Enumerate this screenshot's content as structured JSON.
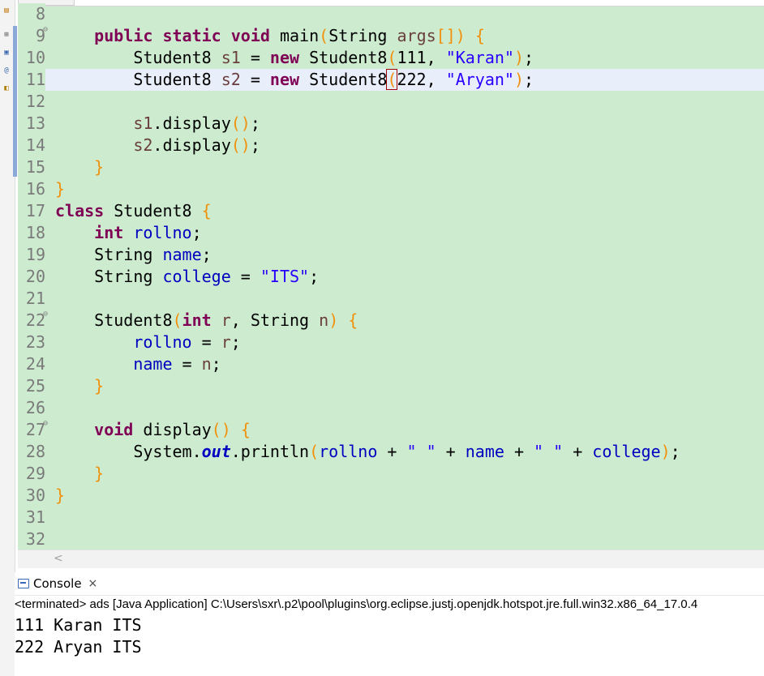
{
  "editor": {
    "lines": [
      {
        "n": "8",
        "fold": false,
        "current": false,
        "tokens": []
      },
      {
        "n": "9",
        "fold": true,
        "current": false,
        "tokens": [
          {
            "t": "    "
          },
          {
            "t": "public",
            "c": "kw"
          },
          {
            "t": " "
          },
          {
            "t": "static",
            "c": "kw"
          },
          {
            "t": " "
          },
          {
            "t": "void",
            "c": "kw"
          },
          {
            "t": " main"
          },
          {
            "t": "(",
            "c": "br"
          },
          {
            "t": "String "
          },
          {
            "t": "args",
            "c": "var"
          },
          {
            "t": "[]",
            "c": "br"
          },
          {
            "t": ")",
            "c": "br"
          },
          {
            "t": " "
          },
          {
            "t": "{",
            "c": "br"
          }
        ]
      },
      {
        "n": "10",
        "fold": false,
        "current": false,
        "tokens": [
          {
            "t": "        Student8 "
          },
          {
            "t": "s1",
            "c": "var"
          },
          {
            "t": " = "
          },
          {
            "t": "new",
            "c": "kw"
          },
          {
            "t": " Student8"
          },
          {
            "t": "(",
            "c": "br"
          },
          {
            "t": "111, "
          },
          {
            "t": "\"Karan\"",
            "c": "str"
          },
          {
            "t": ")",
            "c": "br"
          },
          {
            "t": ";"
          }
        ]
      },
      {
        "n": "11",
        "fold": false,
        "current": true,
        "tokens": [
          {
            "t": "        Student8 "
          },
          {
            "t": "s2",
            "c": "var"
          },
          {
            "t": " = "
          },
          {
            "t": "new",
            "c": "kw"
          },
          {
            "t": " Student8"
          },
          {
            "t": "(",
            "c": "br caret"
          },
          {
            "t": "222, "
          },
          {
            "t": "\"Aryan\"",
            "c": "str"
          },
          {
            "t": ")",
            "c": "br"
          },
          {
            "t": ";"
          }
        ]
      },
      {
        "n": "12",
        "fold": false,
        "current": false,
        "tokens": []
      },
      {
        "n": "13",
        "fold": false,
        "current": false,
        "tokens": [
          {
            "t": "        "
          },
          {
            "t": "s1",
            "c": "var"
          },
          {
            "t": ".display"
          },
          {
            "t": "()",
            "c": "br"
          },
          {
            "t": ";"
          }
        ]
      },
      {
        "n": "14",
        "fold": false,
        "current": false,
        "tokens": [
          {
            "t": "        "
          },
          {
            "t": "s2",
            "c": "var"
          },
          {
            "t": ".display"
          },
          {
            "t": "()",
            "c": "br"
          },
          {
            "t": ";"
          }
        ]
      },
      {
        "n": "15",
        "fold": false,
        "current": false,
        "tokens": [
          {
            "t": "    "
          },
          {
            "t": "}",
            "c": "br"
          }
        ]
      },
      {
        "n": "16",
        "fold": false,
        "current": false,
        "tokens": [
          {
            "t": "}",
            "c": "br"
          }
        ]
      },
      {
        "n": "17",
        "fold": false,
        "current": false,
        "tokens": [
          {
            "t": "class",
            "c": "kw"
          },
          {
            "t": " Student8 "
          },
          {
            "t": "{",
            "c": "br"
          }
        ]
      },
      {
        "n": "18",
        "fold": false,
        "current": false,
        "tokens": [
          {
            "t": "    "
          },
          {
            "t": "int",
            "c": "kw"
          },
          {
            "t": " "
          },
          {
            "t": "rollno",
            "c": "fld"
          },
          {
            "t": ";"
          }
        ]
      },
      {
        "n": "19",
        "fold": false,
        "current": false,
        "tokens": [
          {
            "t": "    String "
          },
          {
            "t": "name",
            "c": "fld"
          },
          {
            "t": ";"
          }
        ]
      },
      {
        "n": "20",
        "fold": false,
        "current": false,
        "tokens": [
          {
            "t": "    String "
          },
          {
            "t": "college",
            "c": "fld"
          },
          {
            "t": " = "
          },
          {
            "t": "\"ITS\"",
            "c": "str"
          },
          {
            "t": ";"
          }
        ]
      },
      {
        "n": "21",
        "fold": false,
        "current": false,
        "tokens": []
      },
      {
        "n": "22",
        "fold": true,
        "current": false,
        "tokens": [
          {
            "t": "    Student8"
          },
          {
            "t": "(",
            "c": "br"
          },
          {
            "t": "int",
            "c": "kw"
          },
          {
            "t": " "
          },
          {
            "t": "r",
            "c": "var"
          },
          {
            "t": ", String "
          },
          {
            "t": "n",
            "c": "var"
          },
          {
            "t": ")",
            "c": "br"
          },
          {
            "t": " "
          },
          {
            "t": "{",
            "c": "br"
          }
        ]
      },
      {
        "n": "23",
        "fold": false,
        "current": false,
        "tokens": [
          {
            "t": "        "
          },
          {
            "t": "rollno",
            "c": "fld"
          },
          {
            "t": " = "
          },
          {
            "t": "r",
            "c": "var"
          },
          {
            "t": ";"
          }
        ]
      },
      {
        "n": "24",
        "fold": false,
        "current": false,
        "tokens": [
          {
            "t": "        "
          },
          {
            "t": "name",
            "c": "fld"
          },
          {
            "t": " = "
          },
          {
            "t": "n",
            "c": "var"
          },
          {
            "t": ";"
          }
        ]
      },
      {
        "n": "25",
        "fold": false,
        "current": false,
        "tokens": [
          {
            "t": "    "
          },
          {
            "t": "}",
            "c": "br"
          }
        ]
      },
      {
        "n": "26",
        "fold": false,
        "current": false,
        "tokens": []
      },
      {
        "n": "27",
        "fold": true,
        "current": false,
        "tokens": [
          {
            "t": "    "
          },
          {
            "t": "void",
            "c": "kw"
          },
          {
            "t": " display"
          },
          {
            "t": "()",
            "c": "br"
          },
          {
            "t": " "
          },
          {
            "t": "{",
            "c": "br"
          }
        ]
      },
      {
        "n": "28",
        "fold": false,
        "current": false,
        "tokens": [
          {
            "t": "        System."
          },
          {
            "t": "out",
            "c": "sf"
          },
          {
            "t": ".println"
          },
          {
            "t": "(",
            "c": "br"
          },
          {
            "t": "rollno",
            "c": "fld"
          },
          {
            "t": " + "
          },
          {
            "t": "\" \"",
            "c": "str"
          },
          {
            "t": " + "
          },
          {
            "t": "name",
            "c": "fld"
          },
          {
            "t": " + "
          },
          {
            "t": "\" \"",
            "c": "str"
          },
          {
            "t": " + "
          },
          {
            "t": "college",
            "c": "fld"
          },
          {
            "t": ")",
            "c": "br"
          },
          {
            "t": ";"
          }
        ]
      },
      {
        "n": "29",
        "fold": false,
        "current": false,
        "tokens": [
          {
            "t": "    "
          },
          {
            "t": "}",
            "c": "br"
          }
        ]
      },
      {
        "n": "30",
        "fold": false,
        "current": false,
        "tokens": [
          {
            "t": "}",
            "c": "br"
          }
        ]
      },
      {
        "n": "31",
        "fold": false,
        "current": false,
        "tokens": []
      },
      {
        "n": "32",
        "fold": false,
        "current": false,
        "tokens": []
      }
    ]
  },
  "scrollbar": {
    "left_arrow": "<"
  },
  "console": {
    "tab_label": "Console",
    "close_glyph": "×",
    "status": "<terminated> ads [Java Application] C:\\Users\\sxr\\.p2\\pool\\plugins\\org.eclipse.justj.openjdk.hotspot.jre.full.win32.x86_64_17.0.4",
    "output": [
      "111 Karan ITS",
      "222 Aryan ITS"
    ]
  },
  "colors": {
    "editor_bg": "#cdeccf",
    "current_line": "#e9eefb",
    "keyword": "#7f0055",
    "string": "#2a00ff",
    "field": "#0000c0",
    "bracket": "#f0900c"
  }
}
